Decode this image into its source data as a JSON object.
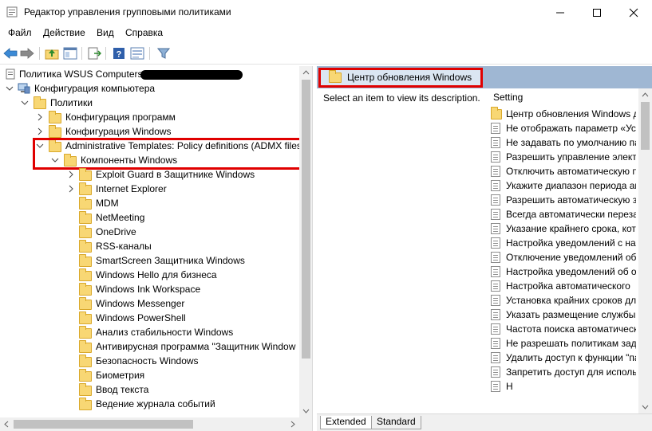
{
  "window": {
    "title": "Редактор управления групповыми политиками",
    "controls": [
      "minimize",
      "maximize",
      "close"
    ]
  },
  "menu": [
    "Файл",
    "Действие",
    "Вид",
    "Справка"
  ],
  "toolbar": [
    "back-arrow-icon",
    "forward-arrow-icon",
    "up-folder-icon",
    "show-hide-tree-icon",
    "export-list-icon",
    "help-icon",
    "properties-icon",
    "filter-icon"
  ],
  "tree": {
    "root": "Политика WSUS Computers",
    "computer_config": "Конфигурация компьютера",
    "policies": "Политики",
    "program_config": "Конфигурация программ",
    "windows_config": "Конфигурация Windows",
    "admin_templates": "Administrative Templates: Policy definitions (ADMX files",
    "windows_components": "Компоненты Windows",
    "children": [
      "Exploit Guard в Защитнике Windows",
      "Internet Explorer",
      "MDM",
      "NetMeeting",
      "OneDrive",
      "RSS-каналы",
      "SmartScreen Защитника Windows",
      "Windows Hello для бизнеса",
      "Windows Ink Workspace",
      "Windows Messenger",
      "Windows PowerShell",
      "Анализ стабильности Windows",
      "Антивирусная программа \"Защитник Window",
      "Безопасность Windows",
      "Биометрия",
      "Ввод текста",
      "Ведение журнала событий"
    ]
  },
  "right": {
    "header": "Центр обновления Windows",
    "description": "Select an item to view its description.",
    "column_header": "Setting",
    "settings": [
      "Центр обновления Windows д",
      "Не отображать параметр «Ус",
      "Не задавать по умолчанию па",
      "Разрешить управление элект",
      "Отключить автоматическую п",
      "Укажите диапазон периода ак",
      "Разрешить автоматическую з",
      "Всегда автоматически переза",
      "Указание крайнего срока, кот",
      "Настройка уведомлений с на",
      "Отключение уведомлений об",
      "Настройка уведомлений об о",
      "Настройка автоматического",
      "Установка крайних сроков дл",
      "Указать размещение службы",
      "Частота поиска автоматическ",
      "Не разрешать политикам зад",
      "Удалить доступ к функции \"па",
      "Запретить доступ для исполь",
      "Н"
    ],
    "tabs": [
      "Extended",
      "Standard"
    ]
  }
}
